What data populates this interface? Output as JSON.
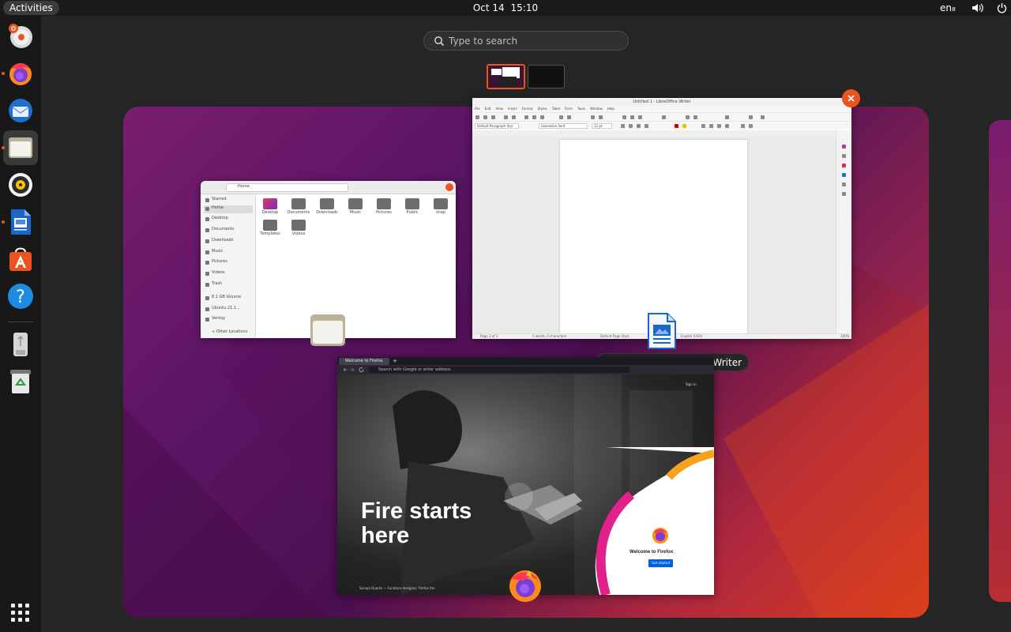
{
  "topbar": {
    "activities_label": "Activities",
    "date": "Oct 14",
    "time": "15:10",
    "input_language": "en₈"
  },
  "dock": {
    "apps": [
      {
        "name": "Ubuntu installer",
        "icon": "installer-icon",
        "running": false
      },
      {
        "name": "Firefox",
        "icon": "firefox-icon",
        "running": true
      },
      {
        "name": "Thunderbird",
        "icon": "thunderbird-icon",
        "running": false
      },
      {
        "name": "Files",
        "icon": "files-icon",
        "running": true,
        "active": true
      },
      {
        "name": "Rhythmbox",
        "icon": "rhythmbox-icon",
        "running": false
      },
      {
        "name": "LibreOffice Writer",
        "icon": "writer-icon",
        "running": true
      },
      {
        "name": "Ubuntu Software",
        "icon": "software-icon",
        "running": false
      },
      {
        "name": "Help",
        "icon": "help-icon",
        "running": false
      },
      {
        "name": "USB drive",
        "icon": "usb-drive-icon",
        "running": false
      },
      {
        "name": "Trash",
        "icon": "trash-icon",
        "running": false
      }
    ]
  },
  "search": {
    "placeholder": "Type to search"
  },
  "files_window": {
    "path": "Home",
    "sidebar": [
      "Starred",
      "Home",
      "Desktop",
      "Documents",
      "Downloads",
      "Music",
      "Pictures",
      "Videos",
      "Trash",
      "8.1 GB Volume",
      "Ubuntu 21.1...",
      "Ventoy",
      "+ Other Locations"
    ],
    "folders": [
      "Desktop",
      "Documents",
      "Downloads",
      "Music",
      "Pictures",
      "Public",
      "snap",
      "Templates",
      "Videos"
    ]
  },
  "writer_window": {
    "title": "Untitled 1 - LibreOffice Writer",
    "menu": [
      "File",
      "Edit",
      "View",
      "Insert",
      "Format",
      "Styles",
      "Table",
      "Form",
      "Tools",
      "Window",
      "Help"
    ],
    "paragraph_style": "Default Paragraph Styl",
    "font_name": "Liberation Serif",
    "font_size": "12 pt",
    "status": {
      "page": "Page 1 of 1",
      "words": "0 words, 0 characters",
      "page_style": "Default Page Style",
      "language": "English (USA)",
      "zoom": "100%"
    }
  },
  "firefox_window": {
    "tab_title": "Welcome to Firefox",
    "url_placeholder": "Search with Google or enter address",
    "headline_1": "Fire starts",
    "headline_2": "here",
    "sign_in": "Sign in",
    "welcome": "Welcome to Firefox",
    "get_started": "Get started",
    "credit": "Soraya Duarte — Furniture designer, Firefox fan"
  },
  "tooltip": "Untitled 1 - LibreOffice Writer",
  "colors": {
    "accent": "#e95420",
    "topbar": "#1a1a1a",
    "dock": "#181818",
    "overview_bg": "#252525"
  }
}
